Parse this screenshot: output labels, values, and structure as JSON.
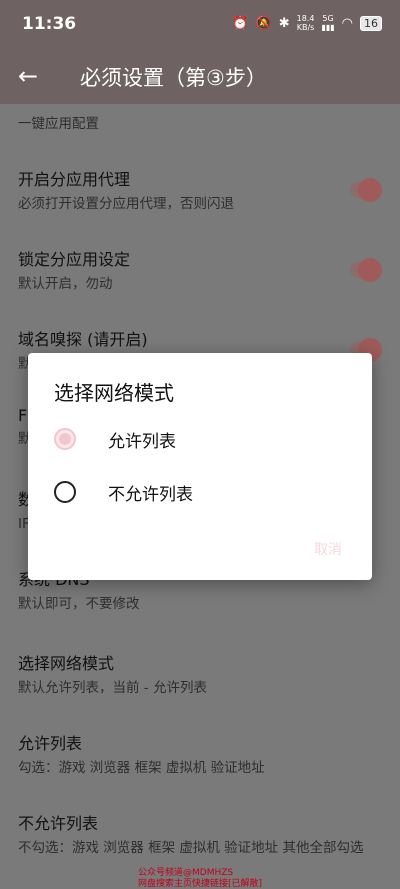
{
  "status_bar": {
    "time": "11:36",
    "net_speed": "18.4",
    "net_unit": "KB/s",
    "signal": "5G",
    "battery": "16"
  },
  "app_bar": {
    "title": "必须设置（第③步）"
  },
  "settings": {
    "partial_top": "一键应用配置",
    "items": [
      {
        "title": "开启分应用代理",
        "subtitle": "必须打开设置分应用代理，否则闪退"
      },
      {
        "title": "锁定分应用设定",
        "subtitle": "默认开启，勿动"
      },
      {
        "title": "域名嗅探 (请开启)",
        "subtitle": "默"
      },
      {
        "title": "F",
        "subtitle": "默"
      },
      {
        "title": "数",
        "subtitle": "IF"
      },
      {
        "title": "系统 DNS",
        "subtitle": "默认即可，不要修改"
      },
      {
        "title": "选择网络模式",
        "subtitle": "默认允许列表，当前 -  允许列表"
      },
      {
        "title": "允许列表",
        "subtitle": "勾选：游戏 浏览器 框架 虚拟机 验证地址"
      },
      {
        "title": "不允许列表",
        "subtitle": "不勾选：游戏 浏览器 框架 虚拟机 验证地址 其他全部勾选"
      }
    ]
  },
  "watermark": {
    "line1": "公众号频道@MDMHZS",
    "line2": "网盘搜索主页快捷链接[已解散]"
  },
  "dialog": {
    "title": "选择网络模式",
    "options": [
      {
        "label": "允许列表",
        "selected": true
      },
      {
        "label": "不允许列表",
        "selected": false
      }
    ],
    "cancel_label": "取消"
  },
  "colors": {
    "accent_pink": "#f2c6cd",
    "scrim": "#7a7a7a"
  }
}
